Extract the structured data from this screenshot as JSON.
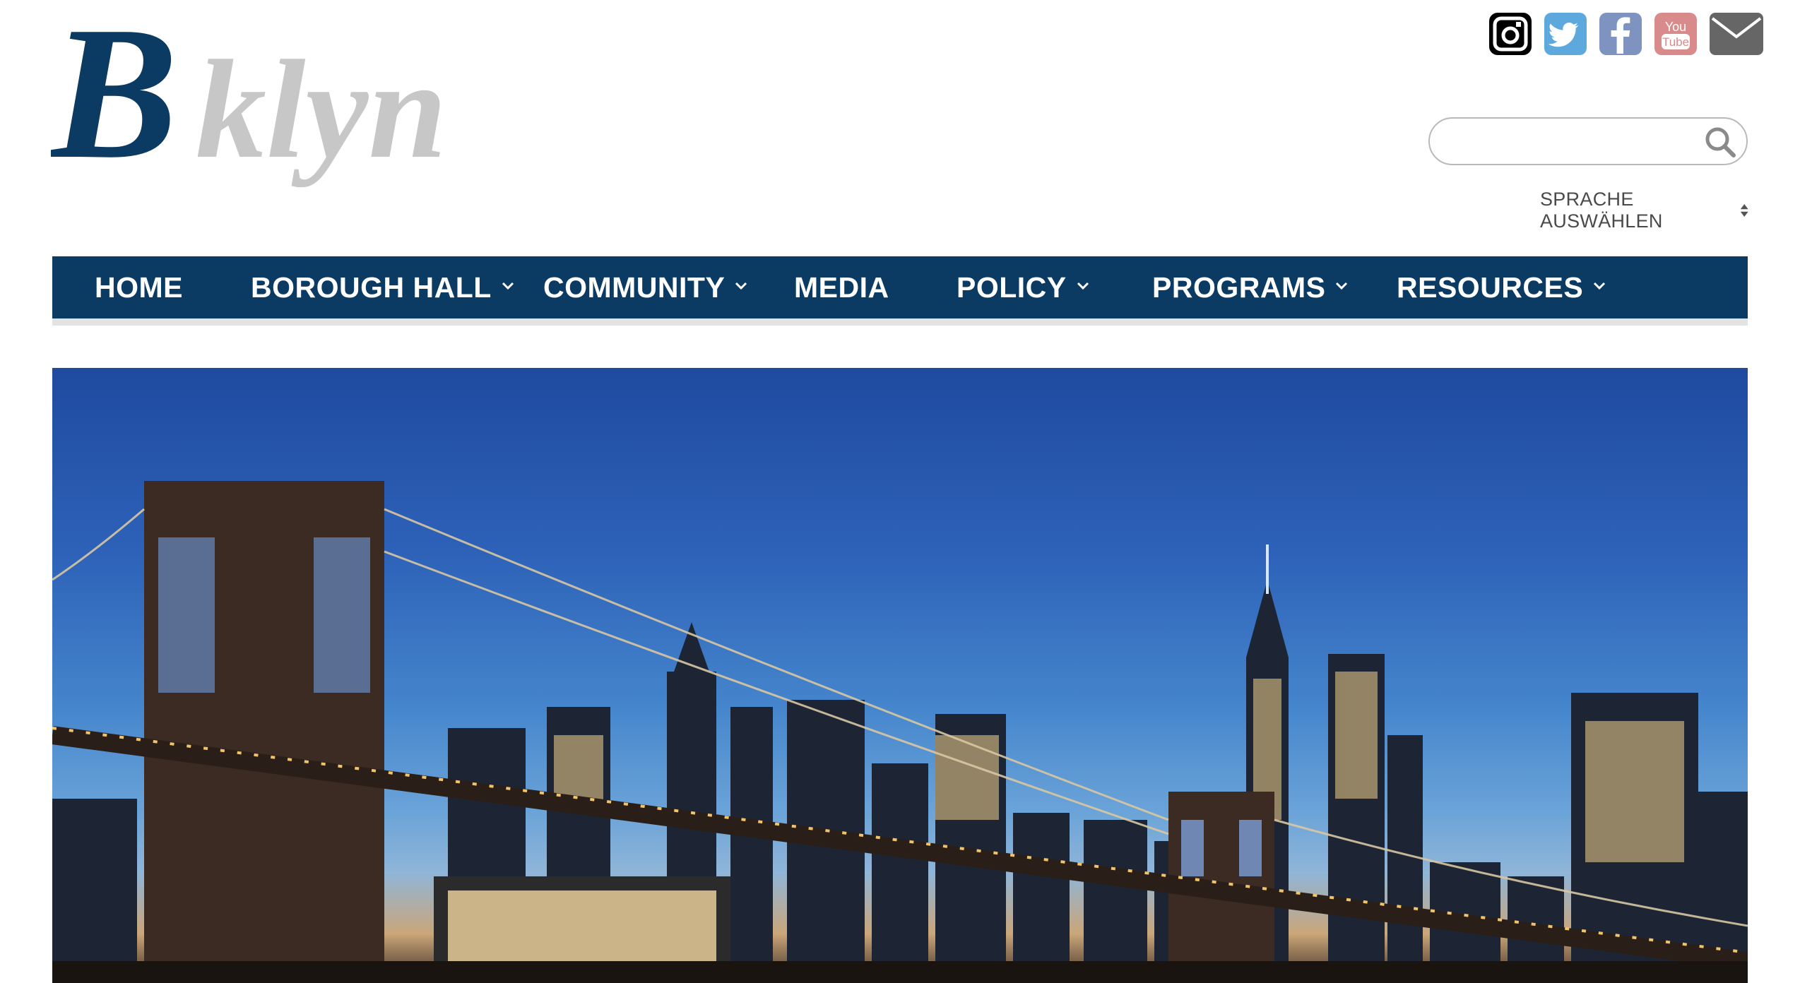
{
  "header": {
    "logo_text": "Bklyn",
    "logo_colors": {
      "b": "#0b3a63",
      "rest": "#c7c7c7"
    }
  },
  "social": [
    {
      "name": "instagram-icon",
      "color": "#000000"
    },
    {
      "name": "twitter-icon",
      "color": "#5da9dd"
    },
    {
      "name": "facebook-icon",
      "color": "#7f93c1"
    },
    {
      "name": "youtube-icon",
      "color": "#d98a8a"
    },
    {
      "name": "mail-icon",
      "color": "#666666"
    }
  ],
  "search": {
    "value": "",
    "placeholder": ""
  },
  "language": {
    "label": "SPRACHE AUSWÄHLEN"
  },
  "nav": {
    "background": "#0b3a63",
    "items": [
      {
        "label": "HOME",
        "has_dropdown": false
      },
      {
        "label": "BOROUGH HALL",
        "has_dropdown": true
      },
      {
        "label": "COMMUNITY",
        "has_dropdown": true
      },
      {
        "label": "MEDIA",
        "has_dropdown": false
      },
      {
        "label": "POLICY",
        "has_dropdown": true
      },
      {
        "label": "PROGRAMS",
        "has_dropdown": true
      },
      {
        "label": "RESOURCES",
        "has_dropdown": true
      }
    ]
  },
  "hero": {
    "subject": "Brooklyn Bridge and Manhattan skyline at dusk"
  }
}
